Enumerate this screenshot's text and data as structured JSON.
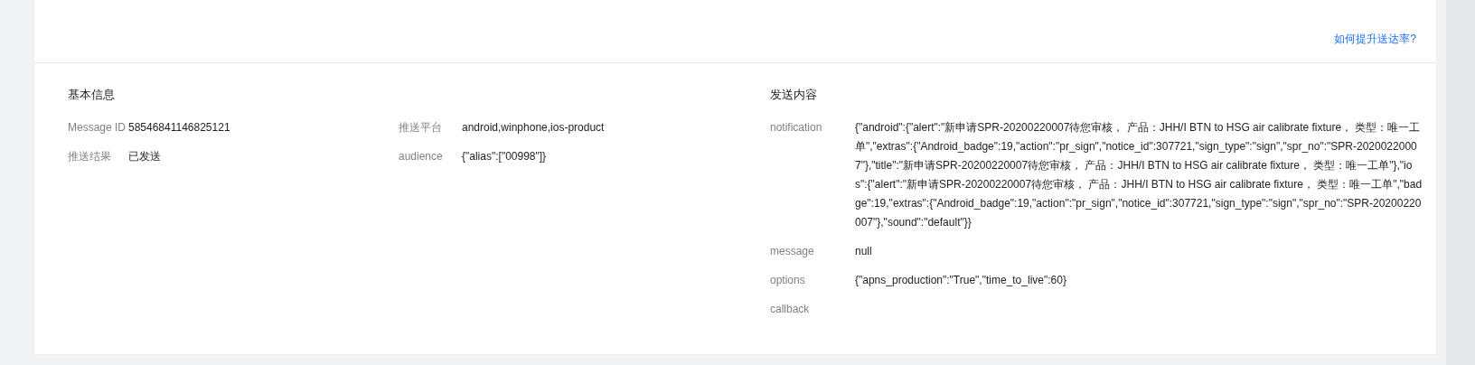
{
  "top_link": "如何提升送达率?",
  "basic_info": {
    "title": "基本信息",
    "fields": [
      {
        "label": "Message ID",
        "value": "58546841146825121"
      },
      {
        "label": "推送平台",
        "value": "android,winphone,ios-product"
      },
      {
        "label": "推送结果",
        "value": "已发送"
      },
      {
        "label": "audience",
        "value": "{\"alias\":[\"00998\"]}"
      }
    ]
  },
  "send_content": {
    "title": "发送内容",
    "fields": [
      {
        "label": "notification",
        "value": "{\"android\":{\"alert\":\"新申请SPR-20200220007待您审核， 产品：JHH/I BTN to HSG air calibrate fixture， 类型：唯一工单\",\"extras\":{\"Android_badge\":19,\"action\":\"pr_sign\",\"notice_id\":307721,\"sign_type\":\"sign\",\"spr_no\":\"SPR-20200220007\"},\"title\":\"新申请SPR-20200220007待您审核， 产品：JHH/I BTN to HSG air calibrate fixture， 类型：唯一工单\"},\"ios\":{\"alert\":\"新申请SPR-20200220007待您审核， 产品：JHH/I BTN to HSG air calibrate fixture， 类型：唯一工单\",\"badge\":19,\"extras\":{\"Android_badge\":19,\"action\":\"pr_sign\",\"notice_id\":307721,\"sign_type\":\"sign\",\"spr_no\":\"SPR-20200220007\"},\"sound\":\"default\"}}"
      },
      {
        "label": "message",
        "value": "null"
      },
      {
        "label": "options",
        "value": "{\"apns_production\":\"True\",\"time_to_live\":60}"
      },
      {
        "label": "callback"
      }
    ]
  }
}
